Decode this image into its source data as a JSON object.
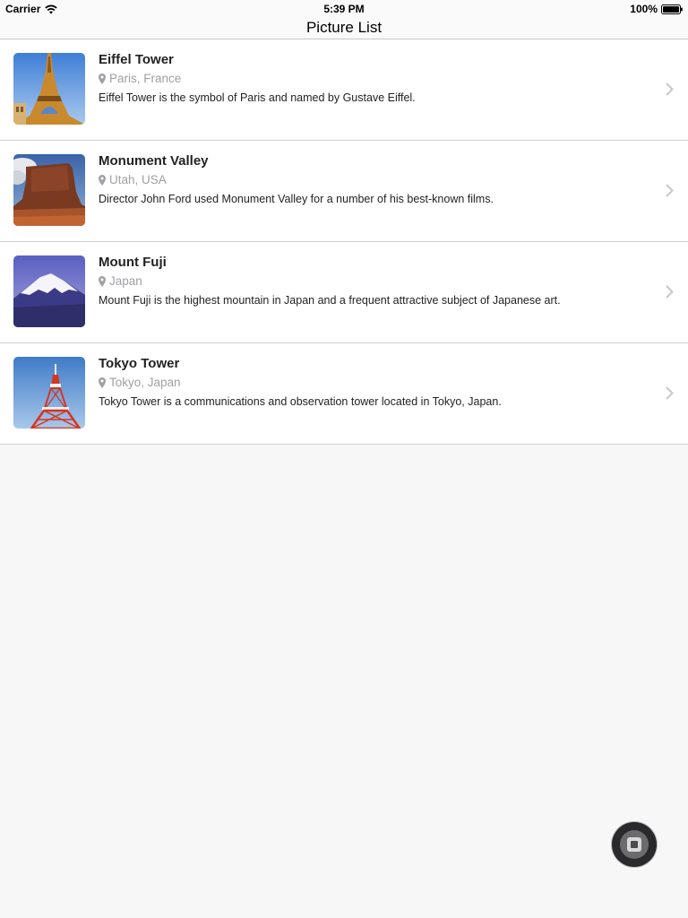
{
  "status_bar": {
    "carrier": "Carrier",
    "time": "5:39 PM",
    "battery": "100%"
  },
  "nav": {
    "title": "Picture List"
  },
  "items": [
    {
      "title": "Eiffel Tower",
      "location": "Paris, France",
      "description": "Eiffel Tower is the symbol of Paris and named by Gustave Eiffel.",
      "thumbnail": "eiffel-tower-photo"
    },
    {
      "title": "Monument Valley",
      "location": "Utah, USA",
      "description": "Director John Ford used Monument Valley for a number of his best-known films.",
      "thumbnail": "monument-valley-photo"
    },
    {
      "title": "Mount Fuji",
      "location": "Japan",
      "description": "Mount Fuji is the highest mountain in Japan and a frequent attractive subject of Japanese art.",
      "thumbnail": "mount-fuji-photo"
    },
    {
      "title": "Tokyo Tower",
      "location": "Tokyo, Japan",
      "description": "Tokyo Tower is a communications and observation tower located in Tokyo, Japan.",
      "thumbnail": "tokyo-tower-photo"
    }
  ],
  "colors": {
    "background": "#f7f7f7",
    "separator": "#d0d0d4",
    "secondary_text": "#a0a0a5"
  }
}
